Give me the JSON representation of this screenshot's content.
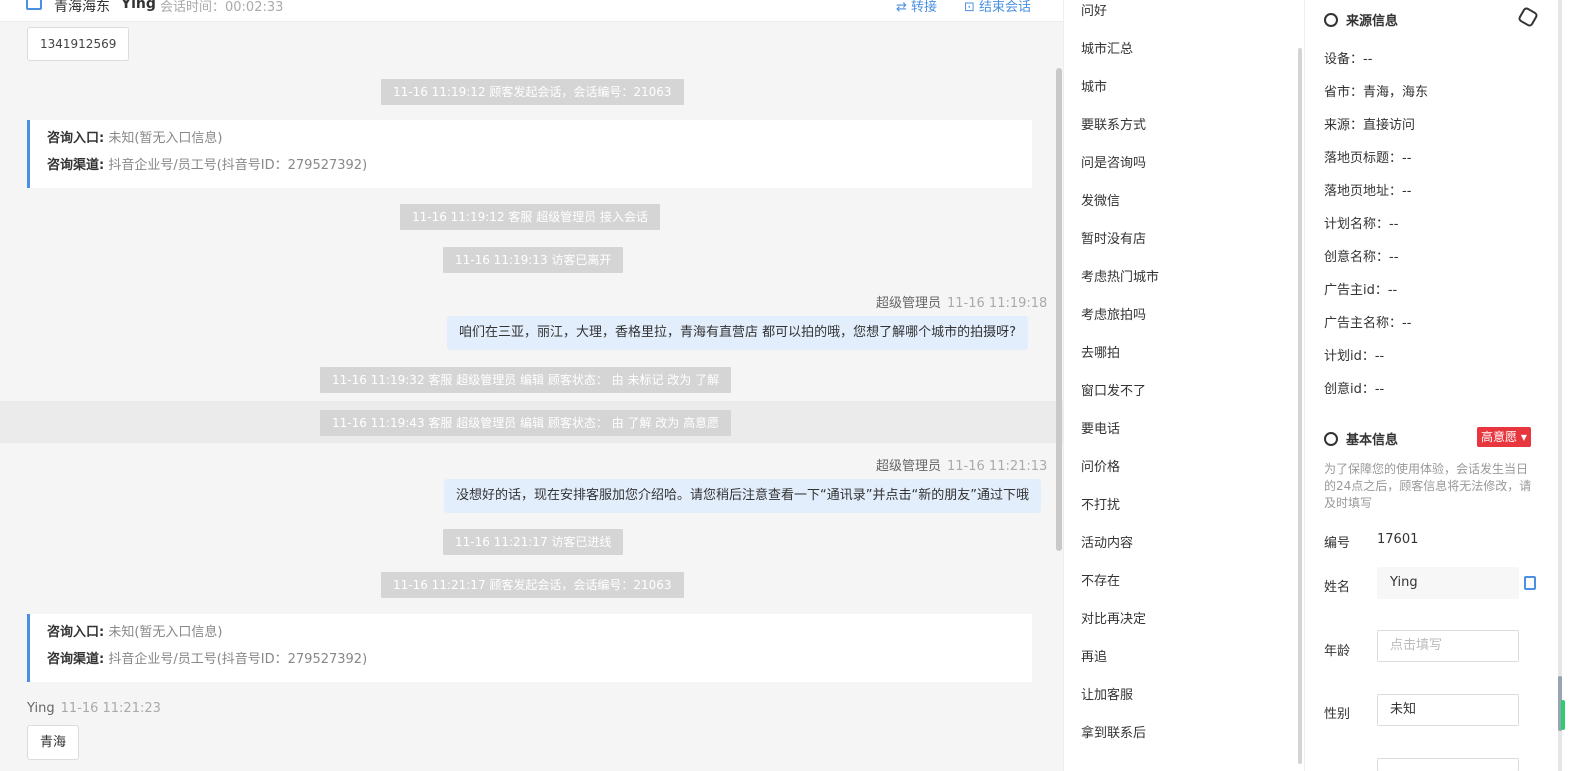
{
  "header": {
    "name": "青海海东",
    "user": "Ying",
    "time": "会话时间：00:02:33",
    "transfer": "⇄ 转接",
    "end": "⊡ 结束会话"
  },
  "chat": {
    "number_box": "1341912569",
    "system_messages": [
      "11-16 11:19:12 顾客发起会话，会话编号：21063",
      "11-16 11:19:12 客服 超级管理员 接入会话",
      "11-16 11:19:13 访客已离开",
      "11-16 11:19:32 客服 超级管理员 编辑 顾客状态： 由 未标记 改为 了解",
      "11-16 11:19:43 客服 超级管理员 编辑 顾客状态： 由 了解 改为 高意愿",
      "11-16 11:21:17 访客已进线",
      "11-16 11:21:17 顾客发起会话，会话编号：21063"
    ],
    "info_cards": [
      {
        "entry_label": "咨询入口:",
        "entry_value": "未知(暂无入口信息)",
        "channel_label": "咨询渠道:",
        "channel_value": "抖音企业号/员工号(抖音号ID：279527392)"
      },
      {
        "entry_label": "咨询入口:",
        "entry_value": "未知(暂无入口信息)",
        "channel_label": "咨询渠道:",
        "channel_value": "抖音企业号/员工号(抖音号ID：279527392)"
      }
    ],
    "agent_messages": [
      {
        "sender": "超级管理员",
        "time": "11-16 11:19:18",
        "text": "咱们在三亚，丽江，大理，香格里拉，青海有直营店 都可以拍的哦，您想了解哪个城市的拍摄呀?"
      },
      {
        "sender": "超级管理员",
        "time": "11-16 11:21:13",
        "text": "没想好的话，现在安排客服加您介绍哈。请您稍后注意查看一下“通讯录”并点击“新的朋友”通过下哦"
      }
    ],
    "visitor_message": {
      "sender": "Ying",
      "time": "11-16 11:21:23",
      "text": "青海"
    }
  },
  "quick_replies": [
    "问好",
    "城市汇总",
    "城市",
    "要联系方式",
    "问是咨询吗",
    "发微信",
    "暂时没有店",
    "考虑热门城市",
    "考虑旅拍吗",
    "去哪拍",
    "窗口发不了",
    "要电话",
    "问价格",
    "不打扰",
    "活动内容",
    "不存在",
    "对比再决定",
    "再追",
    "让加客服",
    "拿到联系后"
  ],
  "source_info": {
    "title": "来源信息",
    "rows": [
      "设备：--",
      "省市：青海，海东",
      "来源：直接访问",
      "落地页标题：--",
      "落地页地址：--",
      "计划名称：--",
      "创意名称：--",
      "广告主id：--",
      "广告主名称：--",
      "计划id：--",
      "创意id：--"
    ]
  },
  "basic_info": {
    "title": "基本信息",
    "badge": "高意愿 ▾",
    "note": "为了保障您的使用体验，会话发生当日的24点之后，顾客信息将无法修改，请及时填写",
    "id_label": "编号",
    "id_value": "17601",
    "name_label": "姓名",
    "name_value": "Ying",
    "age_label": "年龄",
    "age_placeholder": "点击填写",
    "gender_label": "性别",
    "gender_value": "未知"
  },
  "colors": {
    "accent": "#4a90e2",
    "badge": "#e8363f",
    "bubble": "#e3eefd"
  }
}
